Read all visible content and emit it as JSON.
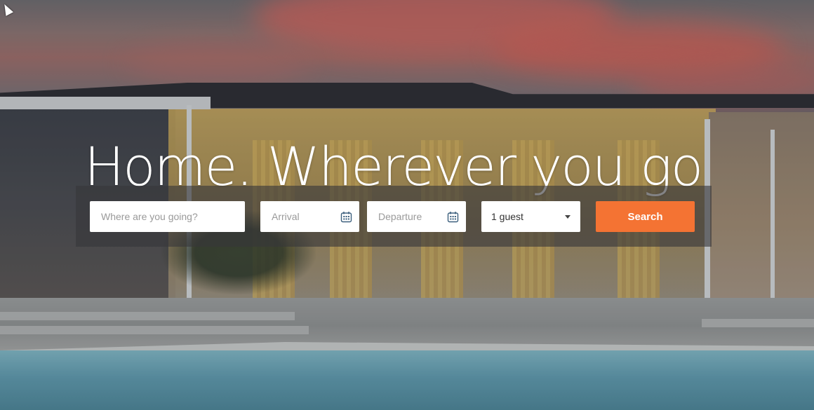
{
  "hero": {
    "headline": "Home. Wherever you go"
  },
  "search": {
    "destination_placeholder": "Where are you going?",
    "arrival_placeholder": "Arrival",
    "departure_placeholder": "Departure",
    "guests_value": "1 guest",
    "search_label": "Search",
    "icons": {
      "arrival": "calendar-icon",
      "departure": "calendar-icon",
      "guests": "chevron-down-icon"
    }
  },
  "colors": {
    "accent": "#f47333",
    "panel": "rgba(55,55,58,0.62)",
    "text_on_hero": "#ffffff"
  }
}
